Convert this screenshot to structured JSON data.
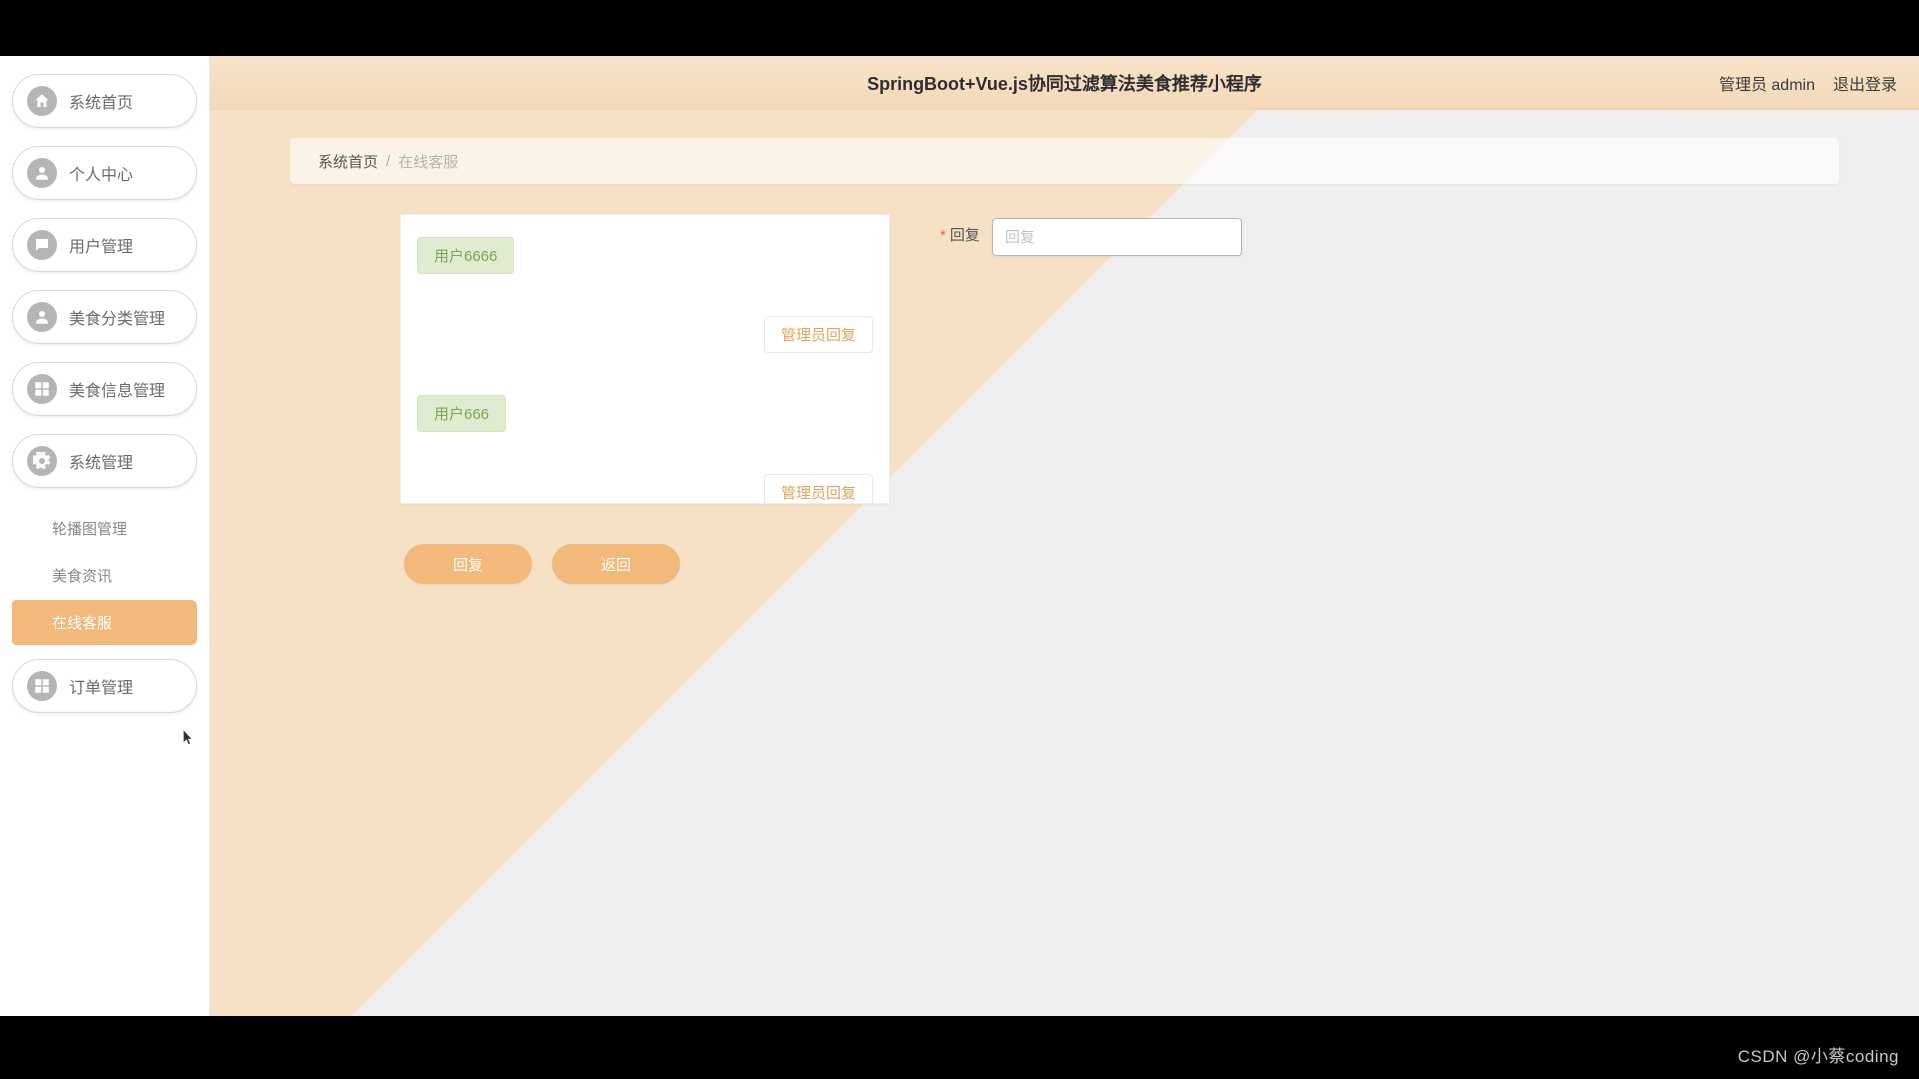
{
  "header": {
    "title": "SpringBoot+Vue.js协同过滤算法美食推荐小程序",
    "user_label": "管理员 admin",
    "logout_label": "退出登录"
  },
  "sidebar": {
    "items": [
      {
        "label": "系统首页",
        "icon": "home"
      },
      {
        "label": "个人中心",
        "icon": "user"
      },
      {
        "label": "用户管理",
        "icon": "chat"
      },
      {
        "label": "美食分类管理",
        "icon": "user"
      },
      {
        "label": "美食信息管理",
        "icon": "grid"
      },
      {
        "label": "系统管理",
        "icon": "gear"
      },
      {
        "label": "订单管理",
        "icon": "grid"
      }
    ],
    "subitems": [
      {
        "label": "轮播图管理",
        "active": false
      },
      {
        "label": "美食资讯",
        "active": false
      },
      {
        "label": "在线客服",
        "active": true
      }
    ]
  },
  "breadcrumb": {
    "home": "系统首页",
    "sep": "/",
    "current": "在线客服"
  },
  "chat": {
    "messages": [
      {
        "side": "left",
        "kind": "user",
        "text": "用户6666"
      },
      {
        "side": "right",
        "kind": "admin",
        "text": "管理员回复"
      },
      {
        "side": "left",
        "kind": "user",
        "text": "用户666"
      },
      {
        "side": "right",
        "kind": "admin",
        "text": "管理员回复"
      }
    ]
  },
  "actions": {
    "reply": "回复",
    "back": "返回"
  },
  "reply_form": {
    "required_mark": "*",
    "label": "回复",
    "placeholder": "回复",
    "value": ""
  },
  "watermark": "CSDN @小蔡coding"
}
